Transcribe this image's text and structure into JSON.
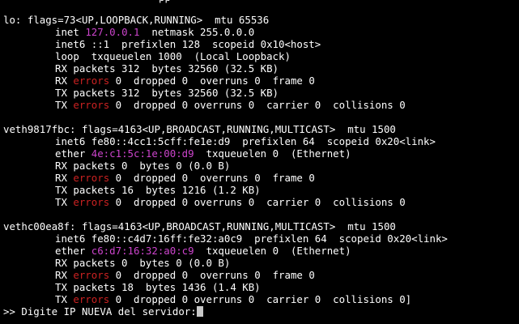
{
  "window": {
    "top_clip": "pp"
  },
  "colors": {
    "background": "#000000",
    "text": "#ffffff",
    "address_highlight": "#cc44cc",
    "error_highlight": "#cc2222"
  },
  "interfaces": [
    {
      "header": "lo: flags=73<UP,LOOPBACK,RUNNING>  mtu 65536",
      "lines": [
        {
          "segments": [
            {
              "text": "inet "
            },
            {
              "text": "127.0.0.1",
              "color": "magenta"
            },
            {
              "text": "  netmask 255.0.0.0"
            }
          ]
        },
        {
          "segments": [
            {
              "text": "inet6 ::1  prefixlen 128  scopeid 0x10<host>"
            }
          ]
        },
        {
          "segments": [
            {
              "text": "loop  txqueuelen 1000  (Local Loopback)"
            }
          ]
        },
        {
          "segments": [
            {
              "text": "RX packets 312  bytes 32560 (32.5 KB)"
            }
          ]
        },
        {
          "segments": [
            {
              "text": "RX "
            },
            {
              "text": "errors",
              "color": "red"
            },
            {
              "text": " 0  dropped 0  overruns 0  frame 0"
            }
          ]
        },
        {
          "segments": [
            {
              "text": "TX packets 312  bytes 32560 (32.5 KB)"
            }
          ]
        },
        {
          "segments": [
            {
              "text": "TX "
            },
            {
              "text": "errors",
              "color": "red"
            },
            {
              "text": " 0  dropped 0 overruns 0  carrier 0  collisions 0"
            }
          ]
        }
      ]
    },
    {
      "header": "veth9817fbc: flags=4163<UP,BROADCAST,RUNNING,MULTICAST>  mtu 1500",
      "lines": [
        {
          "segments": [
            {
              "text": "inet6 fe80::4cc1:5cff:fe1e:d9  prefixlen 64  scopeid 0x20<link>"
            }
          ]
        },
        {
          "segments": [
            {
              "text": "ether "
            },
            {
              "text": "4e:c1:5c:1e:00:d9",
              "color": "magenta"
            },
            {
              "text": "  txqueuelen 0  (Ethernet)"
            }
          ]
        },
        {
          "segments": [
            {
              "text": "RX packets 0  bytes 0 (0.0 B)"
            }
          ]
        },
        {
          "segments": [
            {
              "text": "RX "
            },
            {
              "text": "errors",
              "color": "red"
            },
            {
              "text": " 0  dropped 0  overruns 0  frame 0"
            }
          ]
        },
        {
          "segments": [
            {
              "text": "TX packets 16  bytes 1216 (1.2 KB)"
            }
          ]
        },
        {
          "segments": [
            {
              "text": "TX "
            },
            {
              "text": "errors",
              "color": "red"
            },
            {
              "text": " 0  dropped 0 overruns 0  carrier 0  collisions 0"
            }
          ]
        }
      ]
    },
    {
      "header": "vethc00ea8f: flags=4163<UP,BROADCAST,RUNNING,MULTICAST>  mtu 1500",
      "lines": [
        {
          "segments": [
            {
              "text": "inet6 fe80::c4d7:16ff:fe32:a0c9  prefixlen 64  scopeid 0x20<link>"
            }
          ]
        },
        {
          "segments": [
            {
              "text": "ether "
            },
            {
              "text": "c6:d7:16:32:a0:c9",
              "color": "magenta"
            },
            {
              "text": "  txqueuelen 0  (Ethernet)"
            }
          ]
        },
        {
          "segments": [
            {
              "text": "RX packets 0  bytes 0 (0.0 B)"
            }
          ]
        },
        {
          "segments": [
            {
              "text": "RX "
            },
            {
              "text": "errors",
              "color": "red"
            },
            {
              "text": " 0  dropped 0  overruns 0  frame 0"
            }
          ]
        },
        {
          "segments": [
            {
              "text": "TX packets 18  bytes 1436 (1.4 KB)"
            }
          ]
        },
        {
          "segments": [
            {
              "text": "TX "
            },
            {
              "text": "errors",
              "color": "red"
            },
            {
              "text": " 0  dropped 0 overruns 0  carrier 0  collisions 0]"
            }
          ]
        }
      ]
    }
  ],
  "prompt": {
    "text": ">> Digite IP NUEVA del servidor:"
  }
}
